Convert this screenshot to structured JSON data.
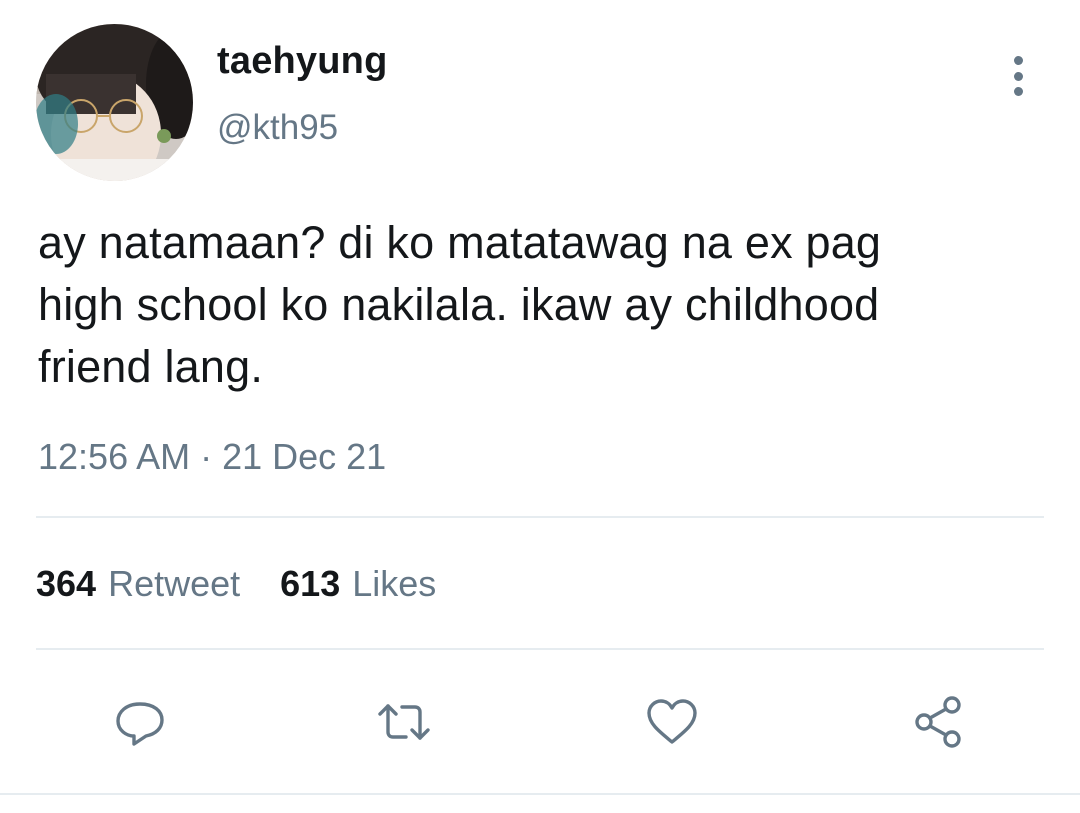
{
  "user": {
    "display_name": "taehyung",
    "handle": "@kth95",
    "avatar_icon": "profile-photo"
  },
  "tweet": {
    "text": "ay natamaan? di ko matatawag na ex pag\nhigh school ko nakilala. ikaw ay childhood\nfriend lang.",
    "timestamp": "12:56 AM · 21 Dec 21"
  },
  "stats": {
    "retweets_count": "364",
    "retweets_label": "Retweet",
    "likes_count": "613",
    "likes_label": "Likes"
  },
  "actions": {
    "reply_icon": "speech-bubble-icon",
    "retweet_icon": "retweet-icon",
    "like_icon": "heart-icon",
    "share_icon": "share-icon"
  },
  "colors": {
    "text_primary": "#14171a",
    "text_secondary": "#657786",
    "divider": "#e6ecf0",
    "background": "#ffffff"
  }
}
